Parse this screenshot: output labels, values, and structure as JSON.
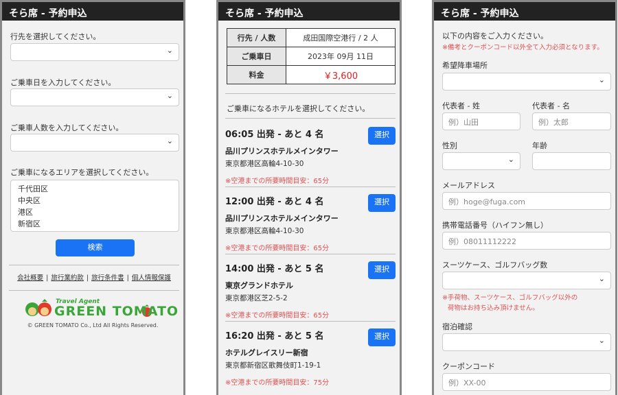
{
  "app_title": "そら席 - 予約申込",
  "screen1": {
    "destination_label": "行先を選択してください。",
    "date_label": "ご乗車日を入力してください。",
    "passengers_label": "ご乗車人数を入力してください。",
    "area_label": "ご乗車になるエリアを選択してください。",
    "areas": [
      "千代田区",
      "中央区",
      "港区",
      "新宿区"
    ],
    "search_button": "検索",
    "footer_links": [
      "会社概要",
      "旅行業約款",
      "旅行条件書",
      "個人情報保護"
    ],
    "logo_small": "Travel Agent",
    "logo_main": "GREEN TOMATO",
    "copyright": "© GREEN TOMATO Co., Ltd All Rights Reserved."
  },
  "screen2": {
    "summary": [
      {
        "label": "行先 / 人数",
        "value": "成田国際空港行 / 2 人"
      },
      {
        "label": "ご乗車日",
        "value": "2023年 09月 11日"
      },
      {
        "label": "料金",
        "value": "￥3,600"
      }
    ],
    "hotel_prompt": "ご乗車になるホテルを選択してください。",
    "select_label": "選択",
    "hotels": [
      {
        "time": "06:05 出発 - あと 4 名",
        "name": "品川プリンスホテルメインタワー",
        "address": "東京都港区高輪4-10-30",
        "duration": "※空港までの所要時間目安：65分"
      },
      {
        "time": "12:00 出発 - あと 4 名",
        "name": "品川プリンスホテルメインタワー",
        "address": "東京都港区高輪4-10-30",
        "duration": "※空港までの所要時間目安：65分"
      },
      {
        "time": "14:00 出発 - あと 5 名",
        "name": "東京グランドホテル",
        "address": "東京都港区芝2-5-2",
        "duration": "※空港までの所要時間目安：65分"
      },
      {
        "time": "16:20 出発 - あと 5 名",
        "name": "ホテルグレイスリー新宿",
        "address": "東京都新宿区歌舞伎町1-19-1",
        "duration": "※空港までの所要時間目安：75分"
      }
    ]
  },
  "screen3": {
    "intro": "以下の内容をご入力ください。",
    "intro_note": "※備考とクーポンコード以外全て入力必須となります。",
    "dropoff_label": "希望降車場所",
    "last_name_label": "代表者 - 姓",
    "last_name_placeholder": "例）山田",
    "first_name_label": "代表者 - 名",
    "first_name_placeholder": "例）太郎",
    "gender_label": "性別",
    "age_label": "年齢",
    "email_label": "メールアドレス",
    "email_placeholder": "例）hoge@fuga.com",
    "phone_label": "携帯電話番号（ハイフン無し）",
    "phone_placeholder": "例）08011112222",
    "luggage_label": "スーツケース、ゴルフバッグ数",
    "luggage_note_1": "※手荷物、スーツケース、ゴルフバッグ以外の",
    "luggage_note_2": "荷物はお持ち込み頂けません。",
    "stay_label": "宿泊確認",
    "coupon_label": "クーポンコード",
    "coupon_placeholder": "例）XX-00"
  },
  "colors": {
    "header": "#222222",
    "accent_blue": "#1a73f5",
    "alert_red": "#e05050",
    "logo_green": "#3aa63a"
  },
  "icons": {
    "dropdown": "chevron-down-icon",
    "logo": "tomato-mascot-icon"
  }
}
